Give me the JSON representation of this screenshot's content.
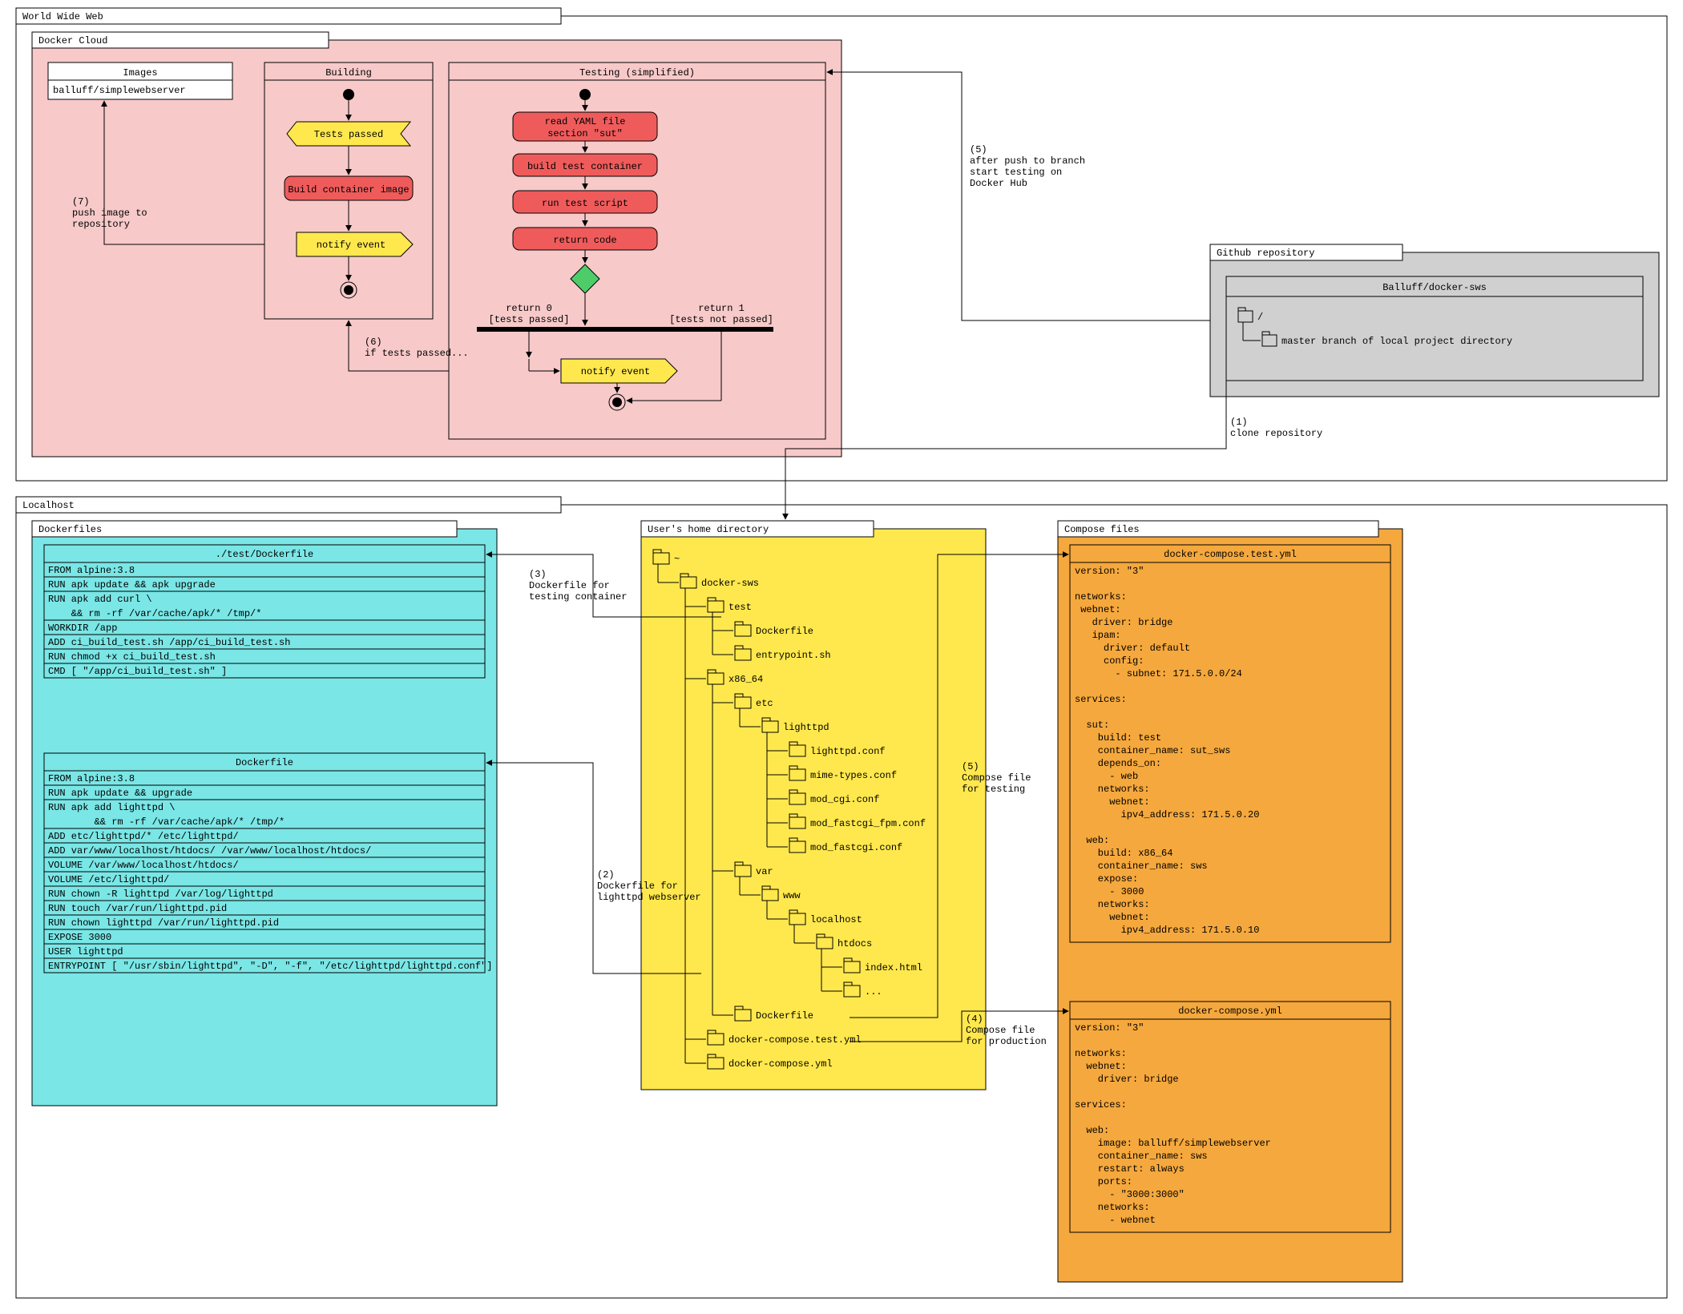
{
  "outer": {
    "title": "World Wide Web"
  },
  "dockerCloud": {
    "title": "Docker Cloud",
    "images": {
      "title": "Images",
      "item": "balluff/simplewebserver"
    },
    "building": {
      "title": "Building",
      "testsPassed": "Tests passed",
      "buildImage": "Build container image",
      "notify": "notify event"
    },
    "testing": {
      "title": "Testing (simplified)",
      "readYaml1": "read YAML file",
      "readYaml2": "section \"sut\"",
      "buildTest": "build test container",
      "runScript": "run test script",
      "returnCode": "return code",
      "branch0a": "return 0",
      "branch0b": "[tests passed]",
      "branch1a": "return 1",
      "branch1b": "[tests not passed]",
      "notify": "notify event"
    }
  },
  "github": {
    "title": "Github repository",
    "repo": "Balluff/docker-sws",
    "root": "/",
    "branch": "master branch of local project directory"
  },
  "localhost": {
    "title": "Localhost"
  },
  "dockerfiles": {
    "title": "Dockerfiles",
    "test": {
      "title": "./test/Dockerfile",
      "lines": [
        "FROM alpine:3.8",
        "RUN apk update && apk upgrade",
        "RUN apk add curl \\",
        "    && rm -rf /var/cache/apk/* /tmp/*",
        "WORKDIR /app",
        "ADD ci_build_test.sh /app/ci_build_test.sh",
        "RUN chmod +x ci_build_test.sh",
        "CMD [ \"/app/ci_build_test.sh\" ]"
      ]
    },
    "main": {
      "title": "Dockerfile",
      "lines": [
        "FROM alpine:3.8",
        "RUN apk update && upgrade",
        "RUN apk add lighttpd \\",
        "        && rm -rf /var/cache/apk/* /tmp/*",
        "ADD etc/lighttpd/* /etc/lighttpd/",
        "ADD var/www/localhost/htdocs/ /var/www/localhost/htdocs/",
        "VOLUME /var/www/localhost/htdocs/",
        "VOLUME /etc/lighttpd/",
        "RUN chown -R lighttpd /var/log/lighttpd",
        "RUN touch /var/run/lighttpd.pid",
        "RUN chown lighttpd /var/run/lighttpd.pid",
        "EXPOSE 3000",
        "USER lighttpd",
        "ENTRYPOINT [ \"/usr/sbin/lighttpd\", \"-D\", \"-f\", \"/etc/lighttpd/lighttpd.conf\"]"
      ]
    }
  },
  "homedir": {
    "title": "User's home directory",
    "tree": [
      {
        "d": 0,
        "n": "~"
      },
      {
        "d": 1,
        "n": "docker-sws"
      },
      {
        "d": 2,
        "n": "test"
      },
      {
        "d": 3,
        "n": "Dockerfile"
      },
      {
        "d": 3,
        "n": "entrypoint.sh"
      },
      {
        "d": 2,
        "n": "x86_64"
      },
      {
        "d": 3,
        "n": "etc"
      },
      {
        "d": 4,
        "n": "lighttpd"
      },
      {
        "d": 5,
        "n": "lighttpd.conf"
      },
      {
        "d": 5,
        "n": "mime-types.conf"
      },
      {
        "d": 5,
        "n": "mod_cgi.conf"
      },
      {
        "d": 5,
        "n": "mod_fastcgi_fpm.conf"
      },
      {
        "d": 5,
        "n": "mod_fastcgi.conf"
      },
      {
        "d": 3,
        "n": "var"
      },
      {
        "d": 4,
        "n": "www"
      },
      {
        "d": 5,
        "n": "localhost"
      },
      {
        "d": 6,
        "n": "htdocs"
      },
      {
        "d": 7,
        "n": "index.html"
      },
      {
        "d": 7,
        "n": "..."
      },
      {
        "d": 3,
        "n": "Dockerfile"
      },
      {
        "d": 2,
        "n": "docker-compose.test.yml"
      },
      {
        "d": 2,
        "n": "docker-compose.yml"
      }
    ]
  },
  "compose": {
    "title": "Compose files",
    "test": {
      "title": "docker-compose.test.yml",
      "body": "version: \"3\"\n\nnetworks:\n webnet:\n   driver: bridge\n   ipam:\n     driver: default\n     config:\n       - subnet: 171.5.0.0/24\n\nservices:\n\n  sut:\n    build: test\n    container_name: sut_sws\n    depends_on:\n      - web\n    networks:\n      webnet:\n        ipv4_address: 171.5.0.20\n\n  web:\n    build: x86_64\n    container_name: sws\n    expose:\n      - 3000\n    networks:\n      webnet:\n        ipv4_address: 171.5.0.10"
    },
    "prod": {
      "title": "docker-compose.yml",
      "body": "version: \"3\"\n\nnetworks:\n  webnet:\n    driver: bridge\n\nservices:\n\n  web:\n    image: balluff/simplewebserver\n    container_name: sws\n    restart: always\n    ports:\n      - \"3000:3000\"\n    networks:\n      - webnet"
    }
  },
  "annotations": {
    "a1": "(1)\nclone repository",
    "a2": "(2)\nDockerfile for\nlighttpd webserver",
    "a3": "(3)\nDockerfile for\ntesting container",
    "a4": "(4)\nCompose file\nfor production",
    "a5r": "(5)\nCompose file\nfor testing",
    "a5top": "(5)\nafter push to branch\nstart testing on\nDocker Hub",
    "a6": "(6)\nif tests passed...",
    "a7": "(7)\npush image to\nrepository"
  },
  "colors": {
    "pink": "#f7c9c9",
    "cyan": "#7ae6e6",
    "yellow": "#ffe84d",
    "yellowNode": "#ffe84d",
    "orange": "#f5a83d",
    "redNode": "#ef5b5b",
    "greenNode": "#4ecc6a",
    "grey": "#d0d0d0"
  }
}
